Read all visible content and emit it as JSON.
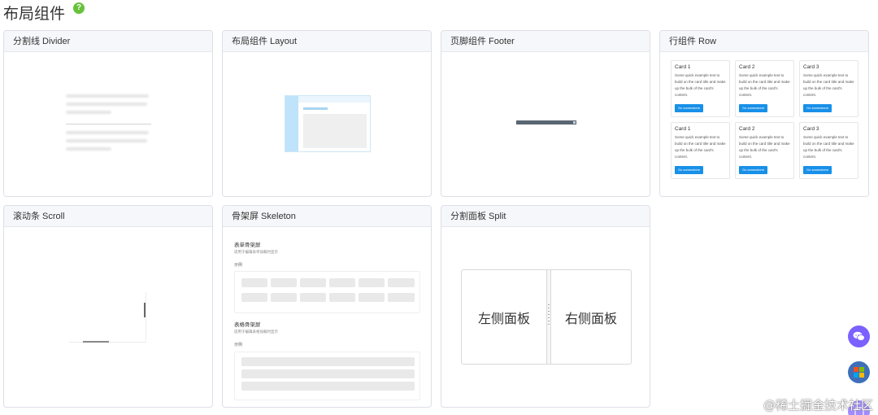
{
  "page": {
    "title": "布局组件",
    "help_icon": "?"
  },
  "cards": {
    "divider": {
      "title": "分割线 Divider"
    },
    "layout": {
      "title": "布局组件 Layout"
    },
    "footer": {
      "title": "页脚组件 Footer"
    },
    "row": {
      "title": "行组件 Row",
      "mini_cards": [
        {
          "title": "Card 1",
          "text": "Some quick example text to build on the card title and make up the bulk of the card's content.",
          "button": "Go somewhere"
        },
        {
          "title": "Card 2",
          "text": "Some quick example text to build on the card title and make up the bulk of the card's content.",
          "button": "Go somewhere"
        },
        {
          "title": "Card 3",
          "text": "Some quick example text to build on the card title and make up the bulk of the card's content.",
          "button": "Go somewhere"
        },
        {
          "title": "Card 1",
          "text": "Some quick example text to build on the card title and make up the bulk of the card's content.",
          "button": "Go somewhere"
        },
        {
          "title": "Card 2",
          "text": "Some quick example text to build on the card title and make up the bulk of the card's content.",
          "button": "Go somewhere"
        },
        {
          "title": "Card 3",
          "text": "Some quick example text to build on the card title and make up the bulk of the card's content.",
          "button": "Go somewhere"
        }
      ]
    },
    "scroll": {
      "title": "滚动条 Scroll"
    },
    "skeleton": {
      "title": "骨架屏 Skeleton",
      "form_heading": "表单骨架屏",
      "form_sub": "适用于编辑表单加载时显示",
      "form_example": "示例",
      "table_heading": "表格骨架屏",
      "table_sub": "适用于编辑表格加载时显示",
      "table_example": "示例"
    },
    "split": {
      "title": "分割面板 Split",
      "left_pane": "左侧面板",
      "right_pane": "右侧面板"
    }
  },
  "floating": {
    "icons": [
      "chat-icon",
      "grid-apps-icon",
      "app-icon"
    ]
  },
  "watermark": "@稀土掘金技术社区",
  "colors": {
    "accent": "#1890e8",
    "help": "#67c23a",
    "fab_chat": "#7b61ff",
    "fab_grid": "#3e6fb8"
  }
}
